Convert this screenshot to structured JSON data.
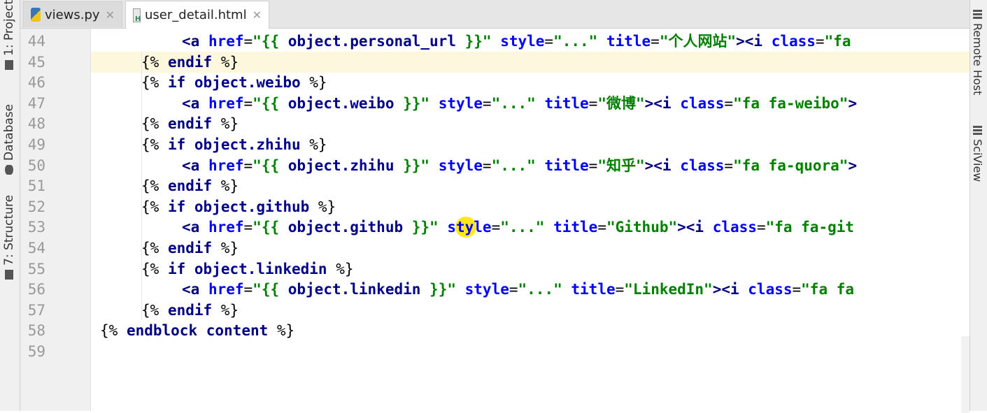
{
  "left_panel": {
    "project_tab": "1: Project",
    "database_tab": "Database",
    "structure_tab": "7: Structure"
  },
  "right_panel": {
    "remote_tab": "Remote Host",
    "sciview_tab": "SciView"
  },
  "tabs": [
    {
      "label": "views.py",
      "icon": "python-file-icon"
    },
    {
      "label": "user_detail.html",
      "icon": "html-file-icon",
      "active": true
    }
  ],
  "editor": {
    "current_line": 45,
    "line_numbers": [
      "44",
      "45",
      "46",
      "47",
      "48",
      "49",
      "50",
      "51",
      "52",
      "53",
      "54",
      "55",
      "56",
      "57",
      "58",
      "59"
    ],
    "lines": [
      [
        {
          "t": "tag",
          "s": "<a "
        },
        {
          "t": "attr",
          "s": "href"
        },
        {
          "t": "punc",
          "s": "="
        },
        {
          "t": "str",
          "s": "\"{{ "
        },
        {
          "t": "var",
          "s": "object.personal_url"
        },
        {
          "t": "str",
          "s": " }}\""
        },
        {
          "t": "punc",
          "s": " "
        },
        {
          "t": "attr",
          "s": "style"
        },
        {
          "t": "punc",
          "s": "="
        },
        {
          "t": "str",
          "s": "\"...\""
        },
        {
          "t": "punc",
          "s": " "
        },
        {
          "t": "attr",
          "s": "title"
        },
        {
          "t": "punc",
          "s": "="
        },
        {
          "t": "str",
          "s": "\"个人网站\""
        },
        {
          "t": "tag",
          "s": "><i "
        },
        {
          "t": "attr",
          "s": "class"
        },
        {
          "t": "punc",
          "s": "="
        },
        {
          "t": "str",
          "s": "\"fa"
        }
      ],
      [
        {
          "t": "plain",
          "s": "{% "
        },
        {
          "t": "kw",
          "s": "endif"
        },
        {
          "t": "plain",
          "s": " %}"
        }
      ],
      [
        {
          "t": "plain",
          "s": "{% "
        },
        {
          "t": "kw",
          "s": "if"
        },
        {
          "t": "plain",
          "s": " "
        },
        {
          "t": "var",
          "s": "object.weibo"
        },
        {
          "t": "plain",
          "s": " %}"
        }
      ],
      [
        {
          "t": "tag",
          "s": "<a "
        },
        {
          "t": "attr",
          "s": "href"
        },
        {
          "t": "punc",
          "s": "="
        },
        {
          "t": "str",
          "s": "\"{{ "
        },
        {
          "t": "var",
          "s": "object.weibo"
        },
        {
          "t": "str",
          "s": " }}\""
        },
        {
          "t": "punc",
          "s": " "
        },
        {
          "t": "attr",
          "s": "style"
        },
        {
          "t": "punc",
          "s": "="
        },
        {
          "t": "str",
          "s": "\"...\""
        },
        {
          "t": "punc",
          "s": " "
        },
        {
          "t": "attr",
          "s": "title"
        },
        {
          "t": "punc",
          "s": "="
        },
        {
          "t": "str",
          "s": "\"微博\""
        },
        {
          "t": "tag",
          "s": "><i "
        },
        {
          "t": "attr",
          "s": "class"
        },
        {
          "t": "punc",
          "s": "="
        },
        {
          "t": "str",
          "s": "\"fa fa-weibo\""
        },
        {
          "t": "tag",
          "s": ">"
        }
      ],
      [
        {
          "t": "plain",
          "s": "{% "
        },
        {
          "t": "kw",
          "s": "endif"
        },
        {
          "t": "plain",
          "s": " %}"
        }
      ],
      [
        {
          "t": "plain",
          "s": "{% "
        },
        {
          "t": "kw",
          "s": "if"
        },
        {
          "t": "plain",
          "s": " "
        },
        {
          "t": "var",
          "s": "object.zhihu"
        },
        {
          "t": "plain",
          "s": " %}"
        }
      ],
      [
        {
          "t": "tag",
          "s": "<a "
        },
        {
          "t": "attr",
          "s": "href"
        },
        {
          "t": "punc",
          "s": "="
        },
        {
          "t": "str",
          "s": "\"{{ "
        },
        {
          "t": "var",
          "s": "object.zhihu"
        },
        {
          "t": "str",
          "s": " }}\""
        },
        {
          "t": "punc",
          "s": " "
        },
        {
          "t": "attr",
          "s": "style"
        },
        {
          "t": "punc",
          "s": "="
        },
        {
          "t": "str",
          "s": "\"...\""
        },
        {
          "t": "punc",
          "s": " "
        },
        {
          "t": "attr",
          "s": "title"
        },
        {
          "t": "punc",
          "s": "="
        },
        {
          "t": "str",
          "s": "\"知乎\""
        },
        {
          "t": "tag",
          "s": "><i "
        },
        {
          "t": "attr",
          "s": "class"
        },
        {
          "t": "punc",
          "s": "="
        },
        {
          "t": "str",
          "s": "\"fa fa-quora\""
        },
        {
          "t": "tag",
          "s": ">"
        }
      ],
      [
        {
          "t": "plain",
          "s": "{% "
        },
        {
          "t": "kw",
          "s": "endif"
        },
        {
          "t": "plain",
          "s": " %}"
        }
      ],
      [
        {
          "t": "plain",
          "s": "{% "
        },
        {
          "t": "kw",
          "s": "if"
        },
        {
          "t": "plain",
          "s": " "
        },
        {
          "t": "var",
          "s": "object.github"
        },
        {
          "t": "plain",
          "s": " %}"
        }
      ],
      [
        {
          "t": "tag",
          "s": "<a "
        },
        {
          "t": "attr",
          "s": "href"
        },
        {
          "t": "punc",
          "s": "="
        },
        {
          "t": "str",
          "s": "\"{{ "
        },
        {
          "t": "var",
          "s": "object.github"
        },
        {
          "t": "str",
          "s": " }}\""
        },
        {
          "t": "punc",
          "s": " "
        },
        {
          "t": "attr",
          "s": "style"
        },
        {
          "t": "punc",
          "s": "="
        },
        {
          "t": "str",
          "s": "\"...\""
        },
        {
          "t": "punc",
          "s": " "
        },
        {
          "t": "attr",
          "s": "title"
        },
        {
          "t": "punc",
          "s": "="
        },
        {
          "t": "str",
          "s": "\"Github\""
        },
        {
          "t": "tag",
          "s": "><i "
        },
        {
          "t": "attr",
          "s": "class"
        },
        {
          "t": "punc",
          "s": "="
        },
        {
          "t": "str",
          "s": "\"fa fa-git"
        }
      ],
      [
        {
          "t": "plain",
          "s": "{% "
        },
        {
          "t": "kw",
          "s": "endif"
        },
        {
          "t": "plain",
          "s": " %}"
        }
      ],
      [
        {
          "t": "plain",
          "s": "{% "
        },
        {
          "t": "kw",
          "s": "if"
        },
        {
          "t": "plain",
          "s": " "
        },
        {
          "t": "var",
          "s": "object.linkedin"
        },
        {
          "t": "plain",
          "s": " %}"
        }
      ],
      [
        {
          "t": "tag",
          "s": "<a "
        },
        {
          "t": "attr",
          "s": "href"
        },
        {
          "t": "punc",
          "s": "="
        },
        {
          "t": "str",
          "s": "\"{{ "
        },
        {
          "t": "var",
          "s": "object.linkedin"
        },
        {
          "t": "str",
          "s": " }}\""
        },
        {
          "t": "punc",
          "s": " "
        },
        {
          "t": "attr",
          "s": "style"
        },
        {
          "t": "punc",
          "s": "="
        },
        {
          "t": "str",
          "s": "\"...\""
        },
        {
          "t": "punc",
          "s": " "
        },
        {
          "t": "attr",
          "s": "title"
        },
        {
          "t": "punc",
          "s": "="
        },
        {
          "t": "str",
          "s": "\"LinkedIn\""
        },
        {
          "t": "tag",
          "s": "><i "
        },
        {
          "t": "attr",
          "s": "class"
        },
        {
          "t": "punc",
          "s": "="
        },
        {
          "t": "str",
          "s": "\"fa fa"
        }
      ],
      [
        {
          "t": "plain",
          "s": "{% "
        },
        {
          "t": "kw",
          "s": "endif"
        },
        {
          "t": "plain",
          "s": " %}"
        }
      ],
      [
        {
          "t": "plain",
          "s": "{% "
        },
        {
          "t": "kw",
          "s": "endblock"
        },
        {
          "t": "plain",
          "s": " "
        },
        {
          "t": "kw",
          "s": "content"
        },
        {
          "t": "plain",
          "s": " %}"
        }
      ],
      []
    ]
  },
  "colors": {
    "current_line_bg": "#fcf7dd",
    "tag": "#000080",
    "attribute": "#0000ff",
    "string": "#008000",
    "cursor_highlight": "#ffe600"
  }
}
